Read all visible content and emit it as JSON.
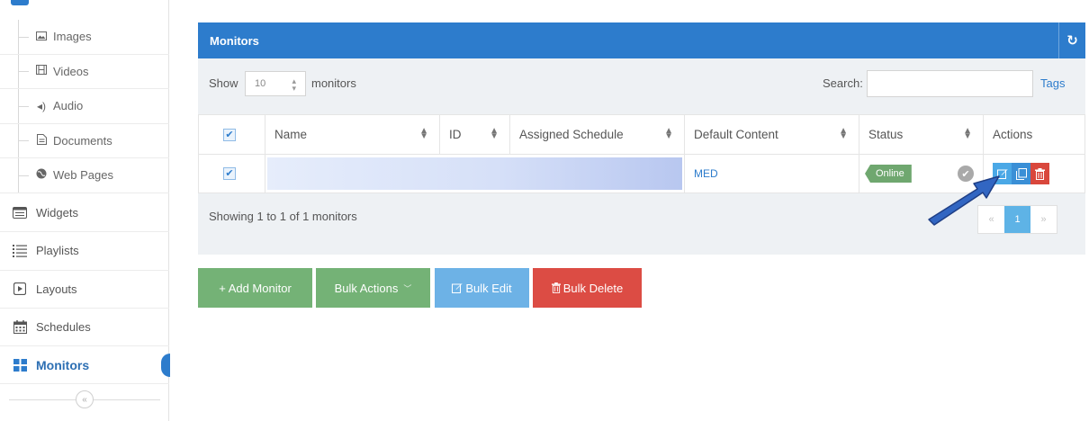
{
  "sidebar": {
    "sub_items": [
      {
        "label": "Images",
        "icon": "image-icon"
      },
      {
        "label": "Videos",
        "icon": "film-icon"
      },
      {
        "label": "Audio",
        "icon": "speaker-icon"
      },
      {
        "label": "Documents",
        "icon": "document-icon"
      },
      {
        "label": "Web Pages",
        "icon": "globe-icon"
      }
    ],
    "main_items": [
      {
        "label": "Widgets",
        "icon": "widgets-icon"
      },
      {
        "label": "Playlists",
        "icon": "list-icon"
      },
      {
        "label": "Layouts",
        "icon": "layouts-icon"
      },
      {
        "label": "Schedules",
        "icon": "calendar-icon"
      },
      {
        "label": "Monitors",
        "icon": "grid-icon",
        "active": true
      }
    ],
    "collapse_glyph": "«"
  },
  "panel": {
    "title": "Monitors",
    "show_label": "Show",
    "page_size": "10",
    "monitors_label": "monitors",
    "search_label": "Search:",
    "search_value": "",
    "tags_label": "Tags",
    "columns": [
      "Name",
      "ID",
      "Assigned Schedule",
      "Default Content",
      "Status",
      "Actions"
    ],
    "rows": [
      {
        "name": "",
        "id": "",
        "assigned_schedule": "",
        "default_content": "MED",
        "status": "Online"
      }
    ],
    "showing_text": "Showing 1 to 1 of 1 monitors",
    "pager": {
      "prev": "«",
      "current": "1",
      "next": "»"
    }
  },
  "buttons": {
    "add_monitor": "+ Add Monitor",
    "bulk_actions": "Bulk Actions",
    "bulk_edit": "Bulk Edit",
    "bulk_delete": "Bulk Delete"
  },
  "colors": {
    "primary": "#2d7ccc",
    "success": "#74b276",
    "info": "#6db2e6",
    "danger": "#dc4c44",
    "online": "#6fa76f"
  }
}
